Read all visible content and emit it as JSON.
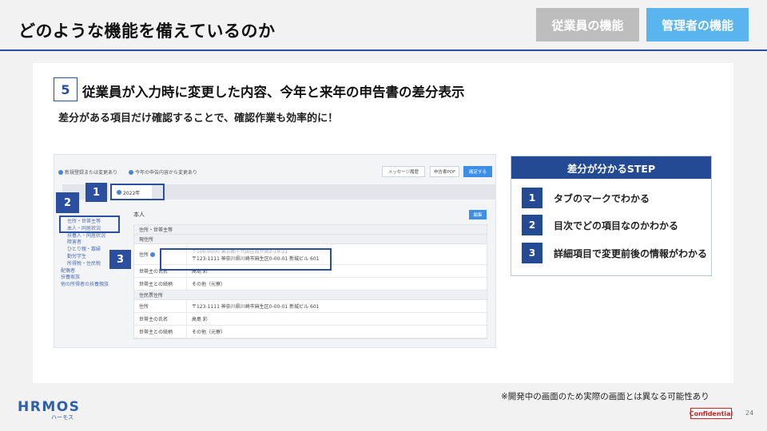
{
  "header": {
    "title": "どのような機能を備えているのか",
    "employee_button": "従業員の機能",
    "admin_button": "管理者の機能"
  },
  "feature": {
    "number": "5",
    "heading": "従業員が入力時に変更した内容、今年と来年の申告書の差分表示",
    "subheading": "差分がある項目だけ確認することで、確認作業も効率的に！"
  },
  "screenshot": {
    "legend_changed": "新規登録または変更あり",
    "legend_diff": "今年の申告内容から変更あり",
    "btn_message": "メッセージ履歴",
    "btn_pdf": "申告書PDF",
    "btn_confirm": "確定する",
    "tab_label": "2022年",
    "section_title": "本人",
    "edit_button": "編集",
    "toc": [
      "住所・世帯主等",
      "本人・同居状況",
      "扶養人・同居状況",
      "障害者",
      "ひとり親・寡婦",
      "勤労学生",
      "所得税・住民税",
      "配偶者",
      "扶養家族",
      "他の所得者の扶養親族"
    ],
    "table": {
      "group": "住所・世帯主等",
      "sub1": "現住所",
      "address_label": "住所",
      "address_old": "〒100-0000 東京都千代田区霞が関2-19-21",
      "address_new": "〒123-1111 神奈川県川崎市麻生区0-00-01 新城ビル 601",
      "householder_name_label": "世帯主の氏名",
      "householder_name": "高島 彩",
      "relation_label": "世帯主との続柄",
      "relation": "その他（元寮）",
      "sub2": "住民票住所",
      "address2": "〒123-1111 神奈川県川崎市麻生区0-00-01 新城ビル 601",
      "householder_name2": "高島 彩",
      "relation2": "その他（元寮）"
    },
    "callouts": [
      "1",
      "2",
      "3"
    ]
  },
  "steps": {
    "title": "差分が分かるSTEP",
    "items": [
      {
        "n": "1",
        "text": "タブのマークでわかる"
      },
      {
        "n": "2",
        "text": "目次でどの項目なのかわかる"
      },
      {
        "n": "3",
        "text": "詳細項目で変更前後の情報がわかる"
      }
    ]
  },
  "footer": {
    "note": "※開発中の画面のため実際の画面とは異なる可能性あり",
    "logo": "HRMOS",
    "logo_sub": "ハーモス",
    "confidential": "Confidential",
    "page_number": "24"
  },
  "colors": {
    "accent": "#2b4f9e",
    "admin_button": "#5ab4ee",
    "employee_button": "#bdbdbd",
    "confidential": "#cc2222"
  }
}
